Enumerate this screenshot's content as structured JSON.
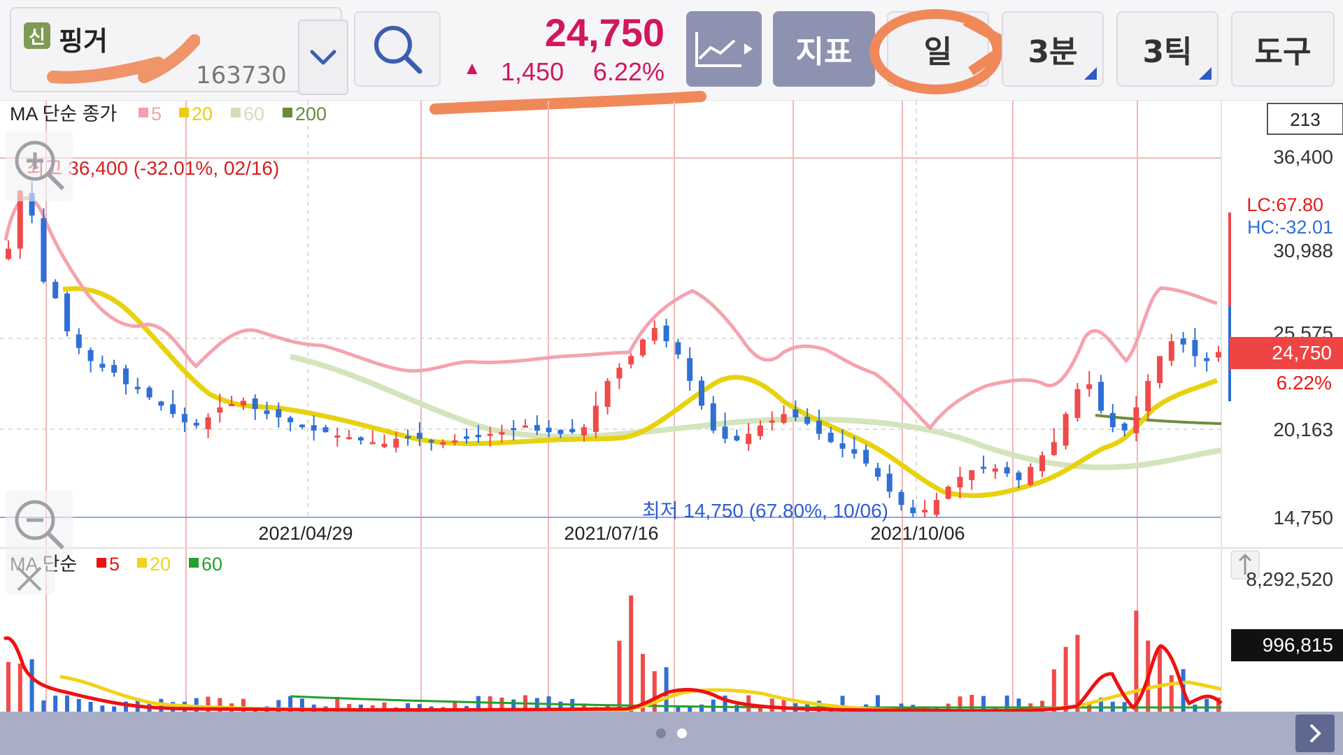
{
  "stock": {
    "badge": "신",
    "name": "핑거",
    "code": "163730",
    "price": "24,750",
    "change_arrow": "▲",
    "change": "1,450",
    "change_pct": "6.22%"
  },
  "toolbar": {
    "indicator_label": "지표",
    "day_label": "일",
    "min3_label": "3분",
    "tick3_label": "3틱",
    "tools_label": "도구"
  },
  "price_panel": {
    "legend_title": "MA 단순 종가",
    "legend": [
      {
        "name": "5",
        "color": "#f4a0ac"
      },
      {
        "name": "20",
        "color": "#e8cf10"
      },
      {
        "name": "60",
        "color": "#cfe0b8"
      },
      {
        "name": "200",
        "color": "#6a8a3a"
      }
    ],
    "high_annotation": "최고 36,400 (-32.01%, 02/16)",
    "low_annotation": "최저 14,750 (67.80%, 10/06)",
    "right_box_value": "213",
    "lc_label": "LC:67.80",
    "hc_label": "HC:-32.01",
    "y_labels": [
      "36,400",
      "30,988",
      "25,575",
      "20,163",
      "14,750"
    ],
    "current_price_tag": "24,750",
    "current_pct_tag": "6.22%",
    "date_labels": [
      "2021/04/29",
      "2021/07/16",
      "2021/10/06"
    ]
  },
  "volume_panel": {
    "legend_title": "MA 단순",
    "legend": [
      {
        "name": "5",
        "color": "#ee1111"
      },
      {
        "name": "20",
        "color": "#f2d21a"
      },
      {
        "name": "60",
        "color": "#22a02a"
      }
    ],
    "max_label": "8,292,520",
    "current_volume": "996,815"
  },
  "colors": {
    "up": "#f04a4a",
    "down": "#2f6fd6",
    "grid_red": "#f2b7b7",
    "accent": "#d2175a"
  },
  "chart_data": {
    "type": "candlestick",
    "price_range": [
      14750,
      36400
    ],
    "high": 36400,
    "low": 14750,
    "last": 24750,
    "daily_close_approx": [
      31000,
      34500,
      33000,
      29000,
      28000,
      26000,
      25000,
      24200,
      23800,
      23500,
      22800,
      22500,
      22000,
      21500,
      21000,
      20500,
      20300,
      20800,
      21400,
      21600,
      21800,
      21300,
      21000,
      20800,
      20500,
      20200,
      20000,
      19900,
      19700,
      19600,
      19400,
      19300,
      19200,
      19500,
      19600,
      19500,
      19400,
      19300,
      19400,
      19500,
      19600,
      19800,
      19900,
      20100,
      20300,
      20000,
      19900,
      19800,
      19900,
      20200,
      21500,
      23000,
      23800,
      24500,
      25500,
      26200,
      25400,
      24600,
      23000,
      21500,
      20000,
      19500,
      19400,
      19800,
      20300,
      20600,
      21000,
      20800,
      20400,
      19800,
      19300,
      18900,
      18600,
      18000,
      17200,
      16300,
      15500,
      15000,
      15200,
      15800,
      16600,
      17200,
      17600,
      17800,
      17700,
      17400,
      17000,
      17800,
      18500,
      19300,
      21000,
      22500,
      22800,
      21200,
      20200,
      20000,
      21400,
      23000,
      24500,
      25400,
      25200,
      24500,
      24200,
      24750
    ]
  }
}
